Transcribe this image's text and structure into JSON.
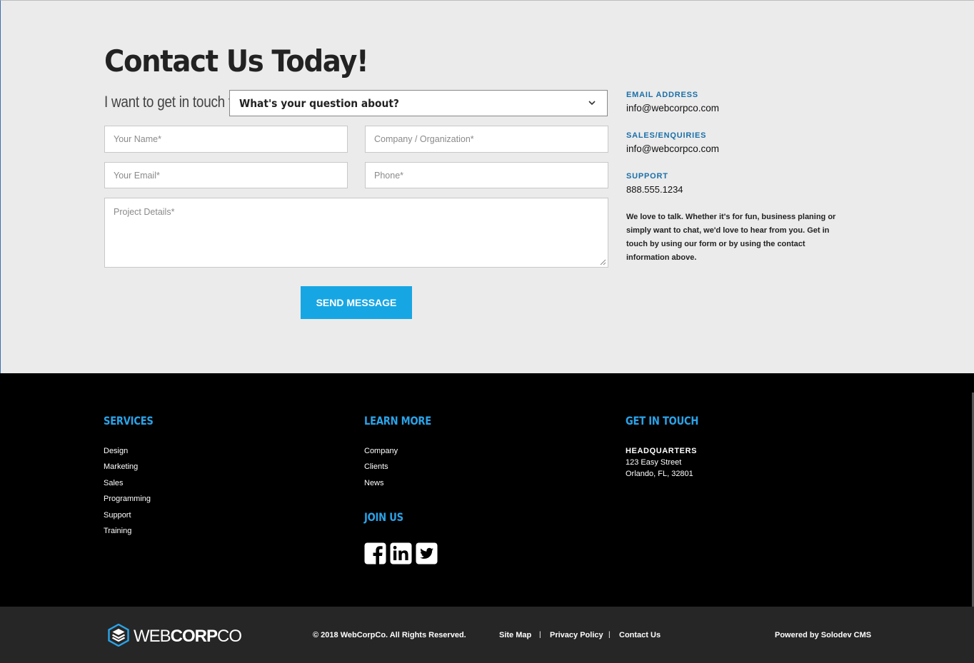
{
  "contact": {
    "title": "Contact Us Today!",
    "touch_label": "I want to get in touch to",
    "select_value": "What's your question about?",
    "fields": {
      "name_placeholder": "Your Name*",
      "company_placeholder": "Company / Organization*",
      "email_placeholder": "Your Email*",
      "phone_placeholder": "Phone*",
      "details_placeholder": "Project Details*"
    },
    "send_label": "SEND MESSAGE"
  },
  "info": {
    "email_label": "EMAIL ADDRESS",
    "email_value": "info@webcorpco.com",
    "sales_label": "SALES/ENQUIRIES",
    "sales_value": "info@webcorpco.com",
    "support_label": "SUPPORT",
    "support_value": "888.555.1234",
    "blurb": "We love to talk. Whether it's for fun, business planing or simply want to chat, we'd love to hear from you. Get in touch by using our form or by using the contact information above."
  },
  "footer": {
    "services": {
      "heading": "SERVICES",
      "items": [
        "Design",
        "Marketing",
        "Sales",
        "Programming",
        "Support",
        "Training"
      ]
    },
    "learn_more": {
      "heading": "LEARN MORE",
      "items": [
        "Company",
        "Clients",
        "News"
      ]
    },
    "join_us": {
      "heading": "JOIN US",
      "icons": [
        "facebook-icon",
        "linkedin-icon",
        "twitter-icon"
      ]
    },
    "get_in_touch": {
      "heading": "GET IN TOUCH",
      "hq_title": "HEADQUARTERS",
      "street": "123 Easy Street",
      "city": "Orlando, FL, 32801"
    }
  },
  "bottom_bar": {
    "logo_light": "WEB",
    "logo_bold": "CORP",
    "logo_end": "CO",
    "copyright": "© 2018 WebCorpCo. All Rights Reserved.",
    "links": [
      "Site Map",
      "Privacy Policy",
      "Contact Us"
    ],
    "powered": "Powered by Solodev CMS"
  },
  "colors": {
    "accent_blue": "#17a6e4",
    "heading_blue": "#2aa3e8",
    "label_blue": "#1a6fa8",
    "page_bg": "#ebebeb",
    "footer_bg": "#000000",
    "bottom_bg": "#262626"
  }
}
